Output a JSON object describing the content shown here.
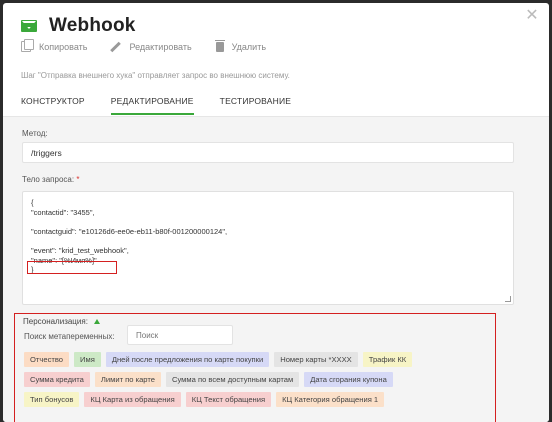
{
  "header": {
    "title": "Webhook",
    "icons": {
      "mail": "mail-icon",
      "close": "close-icon"
    }
  },
  "toolbar": {
    "copy_label": "Копировать",
    "edit_label": "Редактировать",
    "delete_label": "Удалить"
  },
  "description": "Шаг \"Отправка внешнего хука\" отправляет запрос во внешнюю систему.",
  "tabs": [
    {
      "label": "КОНСТРУКТОР"
    },
    {
      "label": "РЕДАКТИРОВАНИЕ"
    },
    {
      "label": "ТЕСТИРОВАНИЕ"
    }
  ],
  "active_tab": "РЕДАКТИРОВАНИЕ",
  "method": {
    "label": "Метод:",
    "value": "/triggers"
  },
  "body": {
    "label": "Тело запроса:",
    "required_mark": "*",
    "lines": [
      "{",
      "\"contactid\": \"3455\",",
      "",
      "\"contactguid\": \"e10126d6-ee0e-eb11-b80f-001200000124\",",
      "",
      "\"event\": \"krid_test_webhook\",",
      "\"name\": \"[%Имя%]\"",
      "}"
    ]
  },
  "personalization": {
    "label": "Персонализация:",
    "search_label": "Поиск метапеременных:",
    "search_placeholder": "Поиск",
    "chips": [
      [
        {
          "label": "Отчество",
          "color": "orange"
        },
        {
          "label": "Имя",
          "color": "green"
        },
        {
          "label": "Дней после предложения по карте покупки",
          "color": "blue"
        },
        {
          "label": "Номер карты *XXXX",
          "color": "gray"
        },
        {
          "label": "Трафик КК",
          "color": "yellow"
        }
      ],
      [
        {
          "label": "Сумма кредита",
          "color": "red"
        },
        {
          "label": "Лимит по карте",
          "color": "peach"
        },
        {
          "label": "Сумма по всем доступным картам",
          "color": "gray"
        },
        {
          "label": "Дата сгорания купона",
          "color": "blue"
        }
      ],
      [
        {
          "label": "Тип бонусов",
          "color": "yellow"
        },
        {
          "label": "КЦ Карта из обращения",
          "color": "red"
        },
        {
          "label": "КЦ Текст обращения",
          "color": "red"
        },
        {
          "label": "КЦ Категория обращения 1",
          "color": "peach"
        }
      ]
    ]
  },
  "colors": {
    "accent": "#3aa83a",
    "highlight": "#d42020",
    "required": "#d9302c"
  }
}
